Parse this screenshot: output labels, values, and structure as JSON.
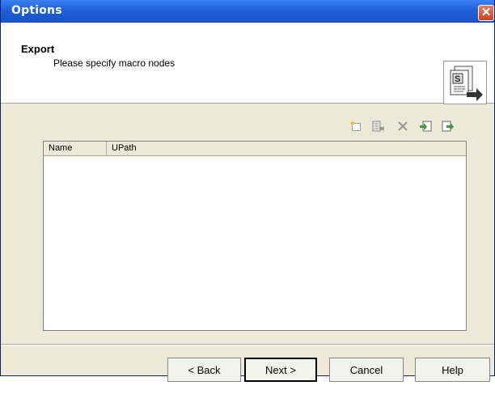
{
  "window": {
    "title": "Options"
  },
  "header": {
    "title": "Export",
    "subtitle": "Please specify macro nodes"
  },
  "toolbar": {
    "buttons": [
      {
        "icon": "new-node-icon"
      },
      {
        "icon": "properties-icon"
      },
      {
        "icon": "delete-icon"
      },
      {
        "icon": "import-icon"
      },
      {
        "icon": "export-icon"
      }
    ]
  },
  "table": {
    "columns": [
      "Name",
      "UPath"
    ],
    "rows": []
  },
  "buttons": {
    "back": "< Back",
    "next": "Next >",
    "cancel": "Cancel",
    "help": "Help"
  },
  "colors": {
    "titlebar": "#1f5fd8",
    "close": "#d9542b",
    "dialog": "#ece9d8",
    "accent_green": "#3c9a3c"
  }
}
